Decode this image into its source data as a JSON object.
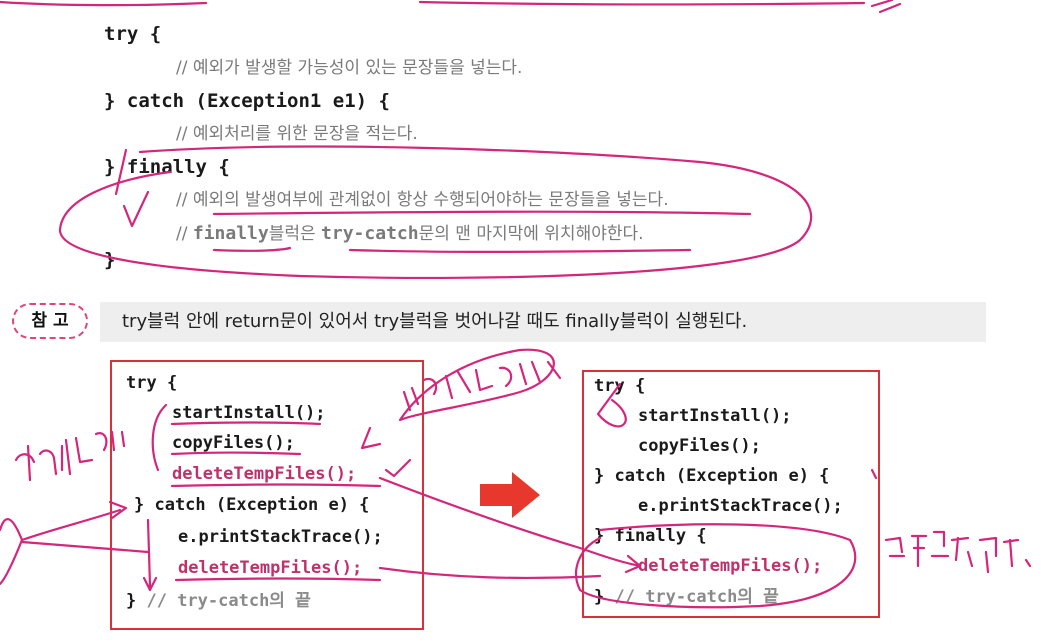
{
  "syntax": {
    "try_open": "try {",
    "comment1": "// 예외가 발생할 가능성이 있는 문장들을 넣는다.",
    "catch_line": "} catch (Exception1 e1) {",
    "comment2": "// 예외처리를 위한 문장을 적는다.",
    "finally_line": "} finally {",
    "comment3": "// 예외의 발생여부에 관계없이 항상 수행되어야하는 문장들을 넣는다.",
    "comment4_prefix": "// ",
    "comment4_kw1": "finally",
    "comment4_mid": "블럭은 ",
    "comment4_kw2": "try-catch",
    "comment4_suffix": "문의 맨 마지막에 위치해야한다.",
    "close": "}"
  },
  "note": {
    "badge": "참 고",
    "text": "try블럭 안에 return문이 있어서 try블럭을 벗어나갈 때도 finally블럭이 실행된다."
  },
  "left_box": {
    "lines": [
      "try {",
      "startInstall();",
      "copyFiles();",
      "deleteTempFiles();",
      "} catch (Exception e) {",
      "e.printStackTrace();",
      "deleteTempFiles();",
      "} ",
      "// try-catch의 끝"
    ]
  },
  "right_box": {
    "lines": [
      "try {",
      "startInstall();",
      "copyFiles();",
      "} catch (Exception e) {",
      "e.printStackTrace();",
      "} finally {",
      "deleteTempFiles();",
      "} ",
      "// try-catch의 끝"
    ]
  },
  "colors": {
    "ink": "#d4267a",
    "box_border": "#d8313a",
    "arrow": "#e8382d",
    "note_bg": "#eeeeee"
  }
}
